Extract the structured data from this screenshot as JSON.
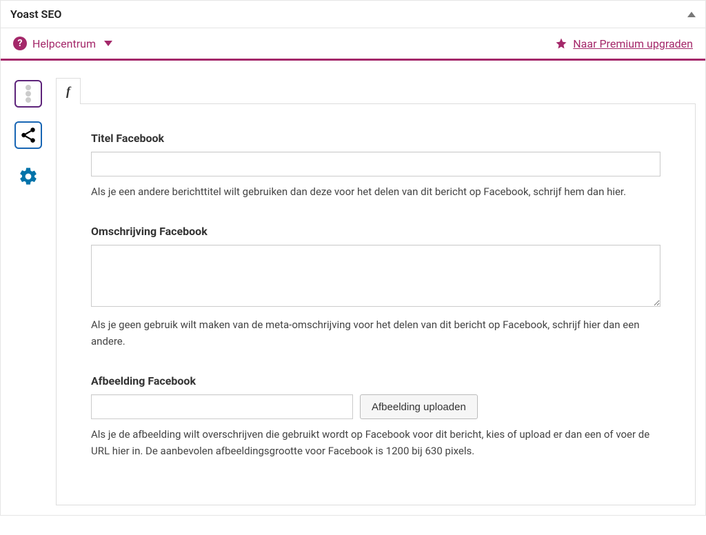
{
  "header": {
    "title": "Yoast SEO"
  },
  "helpbar": {
    "helpcenter_label": "Helpcentrum",
    "upgrade_label": "Naar Premium upgraden"
  },
  "sidetabs": {
    "traffic_name": "readability-tab",
    "share_name": "social-tab",
    "settings_name": "settings-tab"
  },
  "subtab": {
    "facebook_label": "f"
  },
  "fields": {
    "title": {
      "label": "Titel Facebook",
      "value": "",
      "help": "Als je een andere berichttitel wilt gebruiken dan deze voor het delen van dit bericht op Facebook, schrijf hem dan hier."
    },
    "description": {
      "label": "Omschrijving Facebook",
      "value": "",
      "help": "Als je geen gebruik wilt maken van de meta-omschrijving voor het delen van dit bericht op Facebook, schrijf hier dan een andere."
    },
    "image": {
      "label": "Afbeelding Facebook",
      "value": "",
      "upload_button": "Afbeelding uploaden",
      "help": "Als je de afbeelding wilt overschrijven die gebruikt wordt op Facebook voor dit bericht, kies of upload er dan een of voer de URL hier in. De aanbevolen afbeeldingsgrootte voor Facebook is 1200 bij 630 pixels."
    }
  }
}
